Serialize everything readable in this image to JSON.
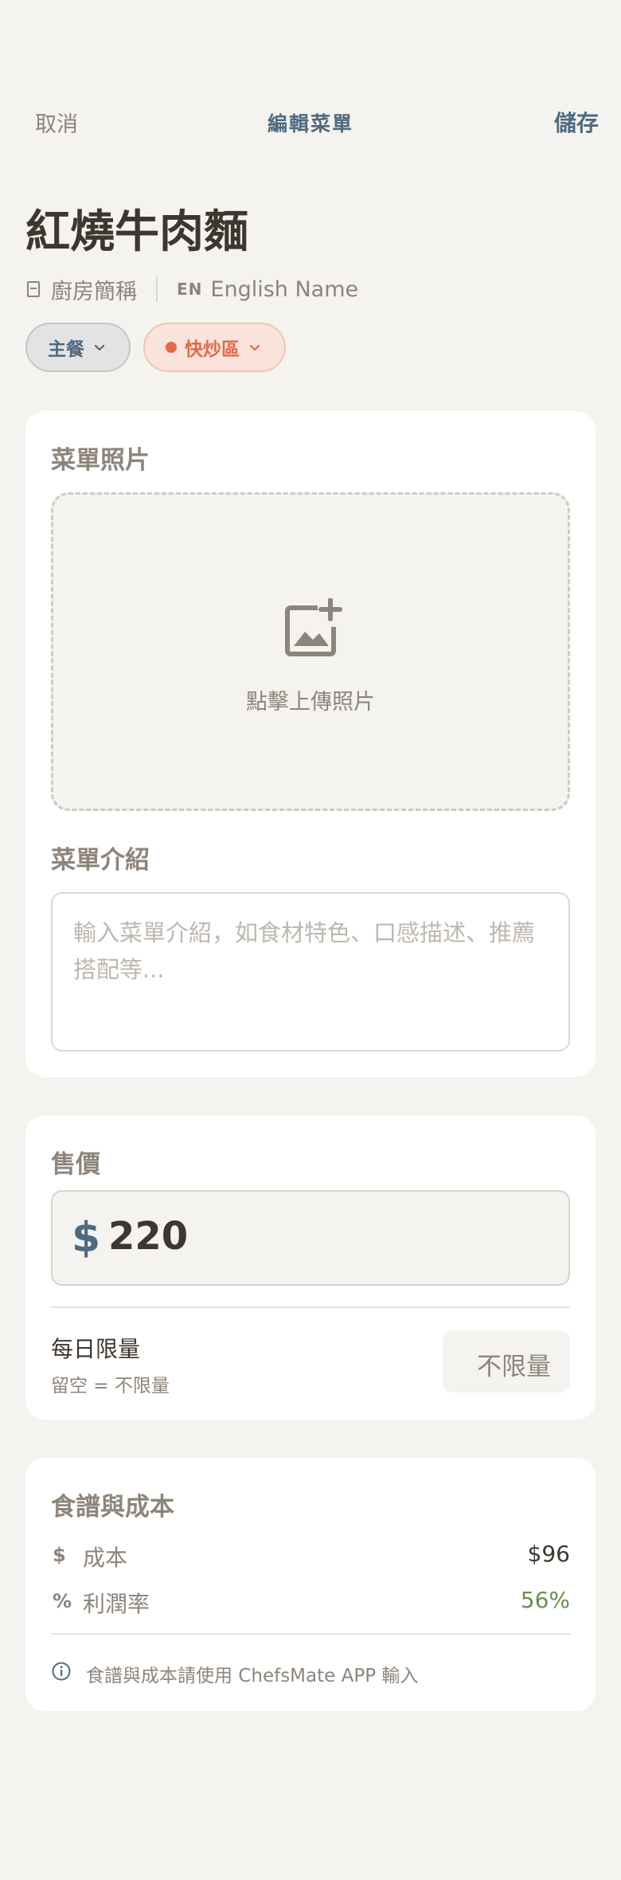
{
  "nav": {
    "cancel_label": "取消",
    "title": "編輯菜單",
    "save_label": "儲存"
  },
  "dish": {
    "name": "紅燒牛肉麵",
    "kitchen_alias_placeholder": "廚房簡稱",
    "english_icon": "EN",
    "english_name_placeholder": "English Name"
  },
  "chips": {
    "course_label": "主餐",
    "station_label": "快炒區",
    "station_color": "#e06a4a",
    "course_color": "#4f6a80"
  },
  "photo": {
    "section_label": "菜單照片",
    "upload_label": "點擊上傳照片",
    "icon": "add-photo-icon"
  },
  "description": {
    "section_label": "菜單介紹",
    "placeholder": "輸入菜單介紹，如食材特色、口感描述、推薦搭配等..."
  },
  "pricing": {
    "section_label": "售價",
    "currency_symbol": "$",
    "price": "220",
    "daily_limit_label": "每日限量",
    "daily_limit_hint": "留空 = 不限量",
    "daily_limit_placeholder": "不限量"
  },
  "recipe": {
    "section_label": "食譜與成本",
    "cost_icon": "$",
    "cost_label": "成本",
    "cost_value": "$96",
    "margin_icon": "%",
    "margin_label": "利潤率",
    "margin_value": "56%",
    "margin_color": "#6f8c4f",
    "info_text": "食譜與成本請使用 ChefsMate APP 輸入"
  }
}
